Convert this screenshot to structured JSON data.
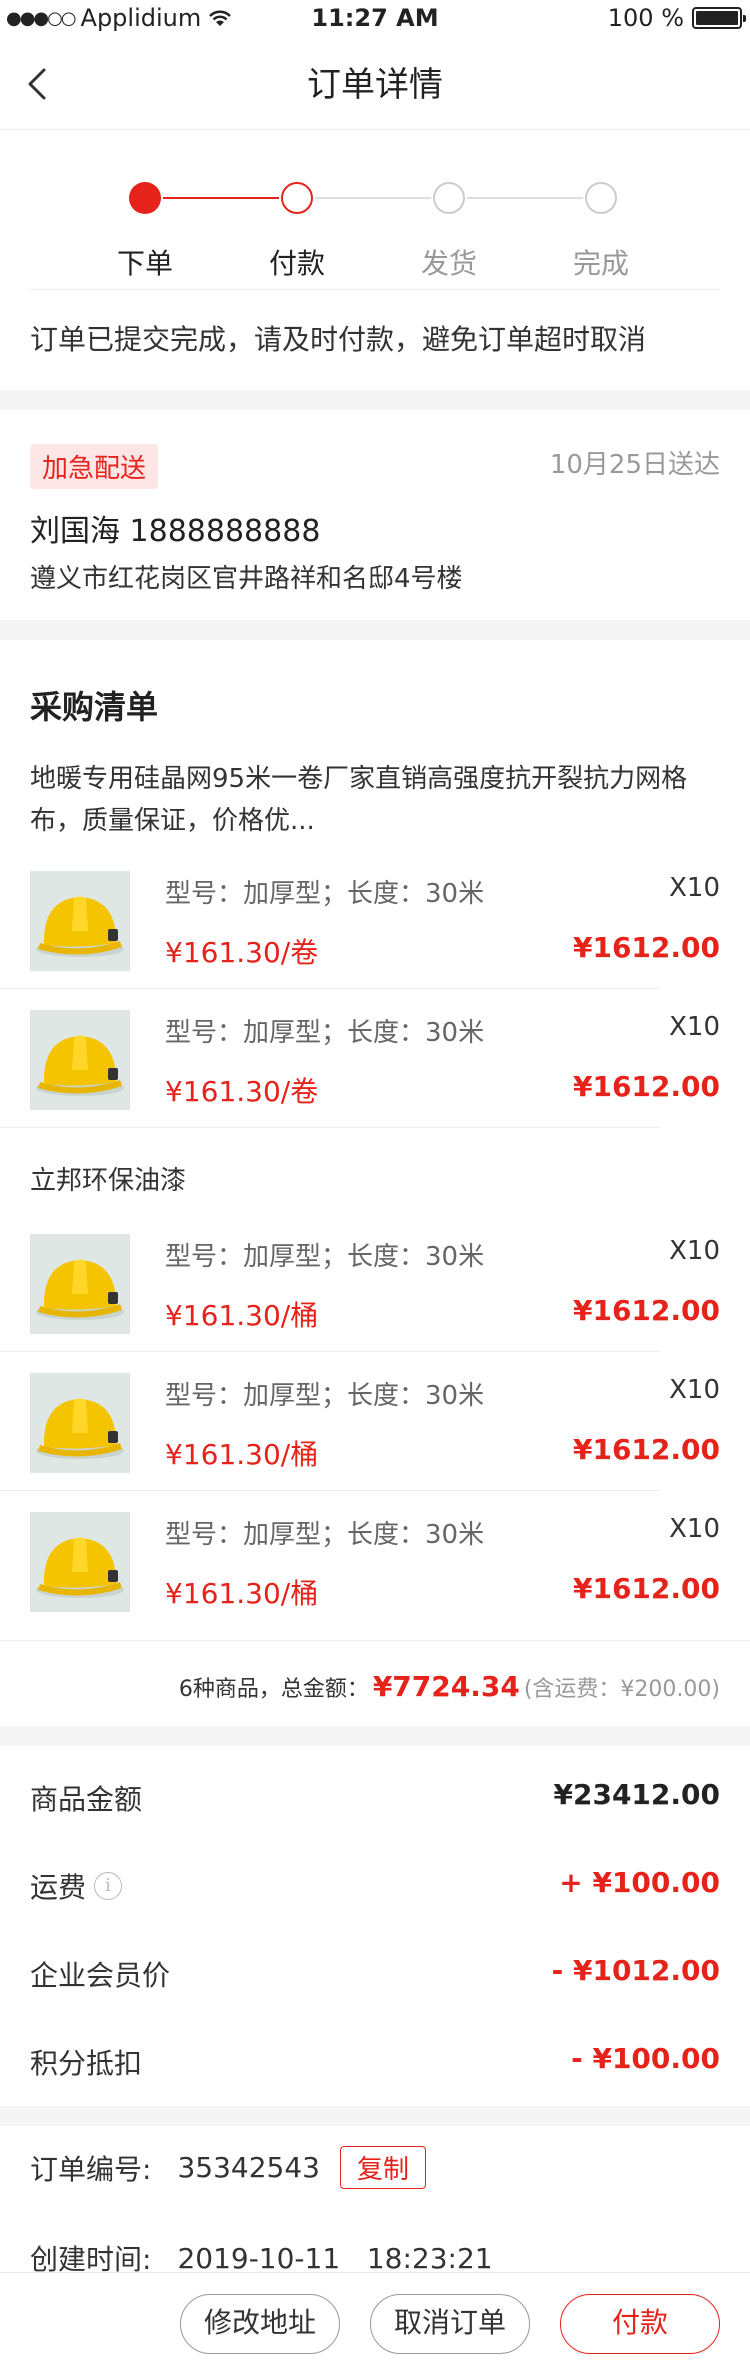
{
  "status_bar": {
    "carrier": "Applidium",
    "time": "11:27 AM",
    "battery": "100 %"
  },
  "nav": {
    "title": "订单详情"
  },
  "progress": {
    "steps": [
      "下单",
      "付款",
      "发货",
      "完成"
    ],
    "current_step": 1,
    "accent": "#e5231b"
  },
  "tip": "订单已提交完成，请及时付款，避免订单超时取消",
  "delivery": {
    "badge": "加急配送",
    "date": "10月25日送达",
    "recipient": "刘国海 1888888888",
    "address": "遵义市红花岗区官井路祥和名邸4号楼"
  },
  "purchase": {
    "title": "采购清单",
    "groups": [
      {
        "name": "地暖专用硅晶网95米一卷厂家直销高强度抗开裂抗力网格布，质量保证，价格优...",
        "items": [
          {
            "spec": "型号：加厚型；长度：30米",
            "qty": "X10",
            "unit_price": "¥161.30/卷",
            "total": "¥1612.00"
          },
          {
            "spec": "型号：加厚型；长度：30米",
            "qty": "X10",
            "unit_price": "¥161.30/卷",
            "total": "¥1612.00"
          }
        ]
      },
      {
        "name": "立邦环保油漆",
        "items": [
          {
            "spec": "型号：加厚型；长度：30米",
            "qty": "X10",
            "unit_price": "¥161.30/桶",
            "total": "¥1612.00"
          },
          {
            "spec": "型号：加厚型；长度：30米",
            "qty": "X10",
            "unit_price": "¥161.30/桶",
            "total": "¥1612.00"
          },
          {
            "spec": "型号：加厚型；长度：30米",
            "qty": "X10",
            "unit_price": "¥161.30/桶",
            "total": "¥1612.00"
          }
        ]
      }
    ],
    "summary": {
      "count_label": "6种商品，总金额：",
      "amount": "¥7724.34",
      "shipping": "(含运费：¥200.00)"
    }
  },
  "fees": [
    {
      "label": "商品金额",
      "value": "¥23412.00",
      "color": "#222222",
      "info": false
    },
    {
      "label": "运费",
      "value": "+ ¥100.00",
      "color": "#e5231b",
      "info": true
    },
    {
      "label": "企业会员价",
      "value": "- ¥1012.00",
      "color": "#e5231b",
      "info": false
    },
    {
      "label": "积分抵扣",
      "value": "- ¥100.00",
      "color": "#e5231b",
      "info": false
    }
  ],
  "order": {
    "number_label": "订单编号:",
    "number": "35342543",
    "copy_label": "复制",
    "created_label": "创建时间:",
    "created": "2019-10-11   18:23:21"
  },
  "actions": {
    "modify_address": "修改地址",
    "cancel_order": "取消订单",
    "pay": "付款"
  }
}
